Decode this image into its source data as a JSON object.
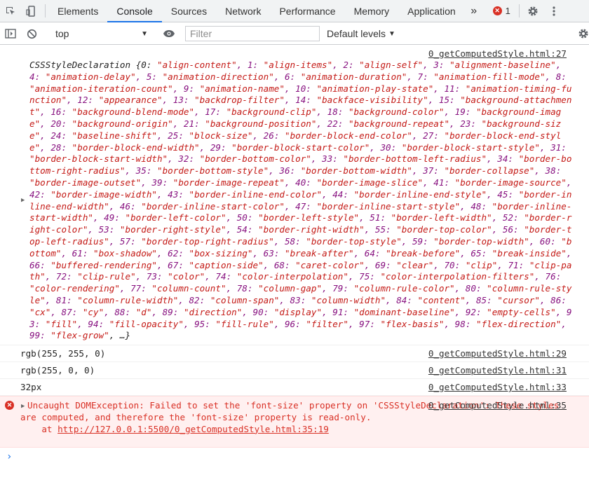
{
  "tabs": [
    "Elements",
    "Console",
    "Sources",
    "Network",
    "Performance",
    "Memory",
    "Application"
  ],
  "more_tabs": "»",
  "error_count": "1",
  "toolbar": {
    "context": "top",
    "filter_placeholder": "Filter",
    "levels": "Default levels"
  },
  "messages": {
    "obj_source": "0_getComputedStyle.html:27",
    "obj_prefix": "CSSStyleDeclaration {0: ",
    "obj_items": [
      "align-content",
      "align-items",
      "align-self",
      "alignment-baseline",
      "animation-delay",
      "animation-direction",
      "animation-duration",
      "animation-fill-mode",
      "animation-iteration-count",
      "animation-name",
      "animation-play-state",
      "animation-timing-function",
      "appearance",
      "backdrop-filter",
      "backface-visibility",
      "background-attachment",
      "background-blend-mode",
      "background-clip",
      "background-color",
      "background-image",
      "background-origin",
      "background-position",
      "background-repeat",
      "background-size",
      "baseline-shift",
      "block-size",
      "border-block-end-color",
      "border-block-end-style",
      "border-block-end-width",
      "border-block-start-color",
      "border-block-start-style",
      "border-block-start-width",
      "border-bottom-color",
      "border-bottom-left-radius",
      "border-bottom-right-radius",
      "border-bottom-style",
      "border-bottom-width",
      "border-collapse",
      "border-image-outset",
      "border-image-repeat",
      "border-image-slice",
      "border-image-source",
      "border-image-width",
      "border-inline-end-color",
      "border-inline-end-style",
      "border-inline-end-width",
      "border-inline-start-color",
      "border-inline-start-style",
      "border-inline-start-width",
      "border-left-color",
      "border-left-style",
      "border-left-width",
      "border-right-color",
      "border-right-style",
      "border-right-width",
      "border-top-color",
      "border-top-left-radius",
      "border-top-right-radius",
      "border-top-style",
      "border-top-width",
      "bottom",
      "box-shadow",
      "box-sizing",
      "break-after",
      "break-before",
      "break-inside",
      "buffered-rendering",
      "caption-side",
      "caret-color",
      "clear",
      "clip",
      "clip-path",
      "clip-rule",
      "color",
      "color-interpolation",
      "color-interpolation-filters",
      "color-rendering",
      "column-count",
      "column-gap",
      "column-rule-color",
      "column-rule-style",
      "column-rule-width",
      "column-span",
      "column-width",
      "content",
      "cursor",
      "cx",
      "cy",
      "d",
      "direction",
      "display",
      "dominant-baseline",
      "empty-cells",
      "fill",
      "fill-opacity",
      "fill-rule",
      "filter",
      "flex-basis",
      "flex-direction",
      "flex-grow"
    ],
    "obj_suffix": ", …}",
    "logs": [
      {
        "text": "rgb(255, 255, 0)",
        "source": "0_getComputedStyle.html:29"
      },
      {
        "text": "rgb(255, 0, 0)",
        "source": "0_getComputedStyle.html:31"
      },
      {
        "text": "32px",
        "source": "0_getComputedStyle.html:33"
      }
    ],
    "error": {
      "source": "0_getComputedStyle.html:35",
      "text": "Uncaught DOMException: Failed to set the 'font-size' property on 'CSSStyleDeclaration': These styles are computed, and therefore the 'font-size' property is read-only.",
      "at_label": "    at ",
      "at_link": "http://127.0.0.1:5500/0_getComputedStyle.html:35:19"
    }
  },
  "colors": {
    "accent": "#1a73e8",
    "error": "#d93025",
    "error_bg": "#fff0f0",
    "key": "#881280",
    "string": "#c41a16"
  }
}
